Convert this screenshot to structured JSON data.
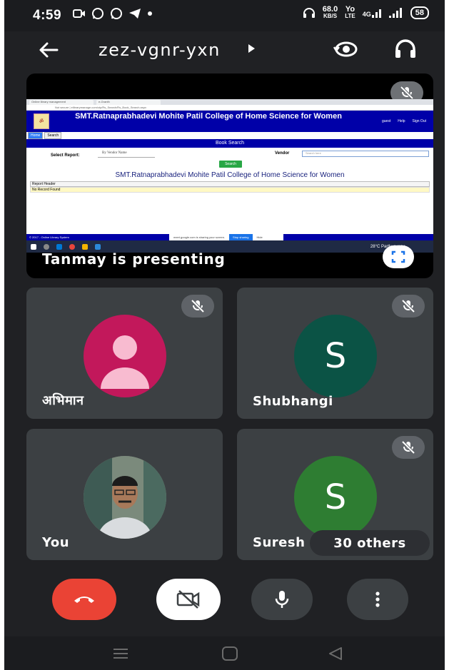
{
  "status_bar": {
    "time": "4:59",
    "net_speed_value": "68.0",
    "net_speed_unit": "KB/S",
    "volte_top": "Yo",
    "volte_bottom": "LTE",
    "network": "4G",
    "battery": "58"
  },
  "header": {
    "meeting_code": "zez-vgnr-yxn"
  },
  "presentation": {
    "presenter_text": "Tanmay is presenting",
    "screen": {
      "tab1": "Online library management",
      "tab2": "e-Granth",
      "url": "Not secure | elibrarymanage.com/ctp/Rs_Search/Rs_Book_Search.aspx",
      "site_title": "SMT.Ratnaprabhadevi Mohite Patil College of Home Science for Women",
      "site_links": [
        "guest",
        "Help",
        "Sign Out"
      ],
      "nav_tabs": [
        "Home",
        "Search"
      ],
      "section_title": "Book Search",
      "select_report_label": "Select Report:",
      "select_report_value": "By Vendor Name",
      "vendor_label": "Vendor",
      "vendor_placeholder": "Search here",
      "search_button": "Search",
      "college_title": "SMT.Ratnaprabhadevi Mohite Patil College of Home Science for Women",
      "report_header": "Report Header",
      "no_record": "No Record Found",
      "footer_text": "© 2017 - Online Library System",
      "share_text": "meet.google.com is sharing your screen.",
      "stop_sharing": "Stop sharing",
      "hide": "Hide",
      "weather": "28°C  Partly sunny"
    }
  },
  "participants": [
    {
      "name": "अभिमान",
      "avatar_type": "generic",
      "avatar_color": "#c2185b"
    },
    {
      "name": "Shubhangi",
      "initial": "S",
      "avatar_color": "#0b5345"
    },
    {
      "name": "You",
      "avatar_type": "photo"
    },
    {
      "name": "Suresh",
      "initial": "S",
      "avatar_color": "#2e7d32"
    }
  ],
  "others_label": "30 others",
  "controls": {
    "end_call_color": "#ea4335"
  }
}
